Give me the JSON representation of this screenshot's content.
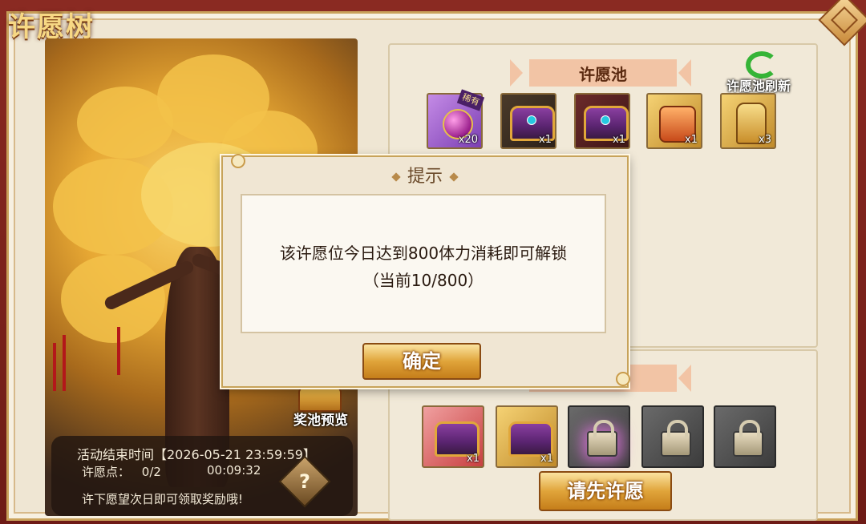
{
  "title": "许愿树",
  "pool_banner": "许愿池",
  "refresh_label": "许愿池刷新",
  "pool_items": [
    {
      "icon": "purple-orb-chest-icon",
      "qty": "x20",
      "badge": "稀有"
    },
    {
      "icon": "dark-chest-icon",
      "qty": "x1"
    },
    {
      "icon": "maroon-chest-icon",
      "qty": "x1"
    },
    {
      "icon": "scroll-bundle-icon",
      "qty": "x1"
    },
    {
      "icon": "wish-tag-icon",
      "qty": "x3"
    }
  ],
  "wish_slots": [
    {
      "icon": "red-chest-icon",
      "qty": "x1"
    },
    {
      "icon": "gold-chest-icon",
      "qty": "x1"
    },
    {
      "icon": "lock-icon",
      "state": "unlockable"
    },
    {
      "icon": "lock-icon",
      "state": "locked"
    },
    {
      "icon": "lock-icon",
      "state": "locked"
    }
  ],
  "wish_button": "请先许愿",
  "pool_preview": "奖池预览",
  "info": {
    "end_time_label": "活动结束时间【2026-05-21 23:59:59】",
    "points_label": "许愿点：",
    "points_value": "0/2",
    "countdown": "00:09:32",
    "hint": "许下愿望次日即可领取奖励哦!"
  },
  "help_icon_text": "?",
  "dialog": {
    "title": "提示",
    "message_line1": "该许愿位今日达到800体力消耗即可解锁",
    "message_line2": "（当前10/800）",
    "ok_button": "确定"
  },
  "colors": {
    "panel_bg": "#efe6d3",
    "banner_bg": "#f2c4a5",
    "button_gold": "#e0a43a",
    "title_gold": "#f7d884"
  }
}
